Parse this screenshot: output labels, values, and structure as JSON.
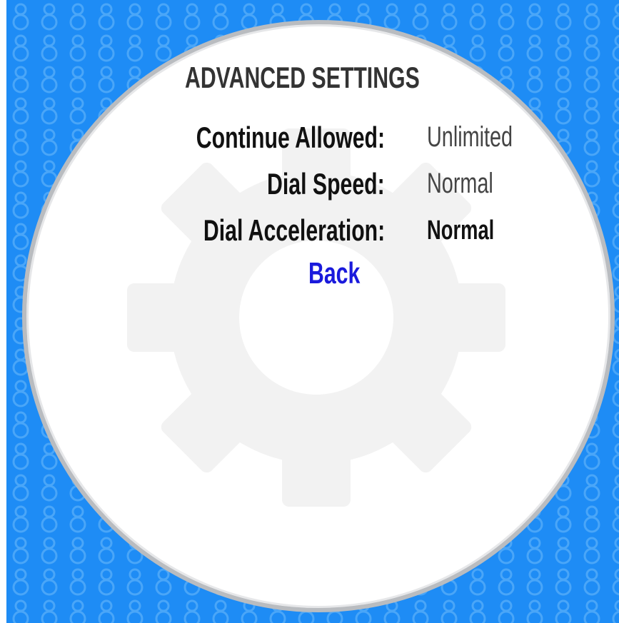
{
  "screen": {
    "title": "ADVANCED SETTINGS"
  },
  "settings": [
    {
      "label": "Continue Allowed:",
      "value": "Unlimited"
    },
    {
      "label": "Dial Speed:",
      "value": "Normal"
    },
    {
      "label": "Dial Acceleration:",
      "value": "Normal"
    }
  ],
  "actions": {
    "back_label": "Back"
  },
  "colors": {
    "background_blue": "#1e8cf5",
    "pattern_blue": "#4aa6f8",
    "gear_gray": "#f2f2f2",
    "back_link": "#1a1adc"
  },
  "icons": {
    "background": "lock-pattern",
    "watermark": "gear-icon"
  }
}
